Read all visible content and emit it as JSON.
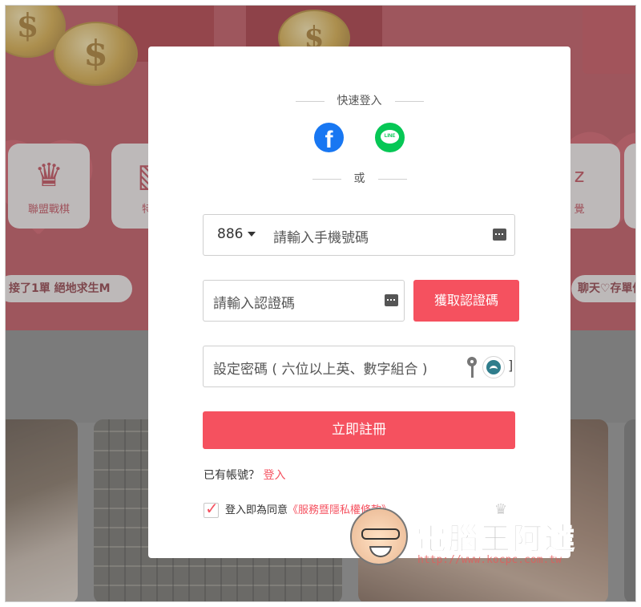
{
  "background": {
    "categories": [
      {
        "label": "聯盟戰棋",
        "icon": "crown-icon"
      },
      {
        "label": "特戰",
        "icon": "poster-icon"
      },
      {
        "label": "覺",
        "icon": "sleep-icon"
      }
    ],
    "ticker_left": "接了1單 絕地求生M",
    "ticker_right": "聊天♡存單優",
    "coin_symbol": "$"
  },
  "modal": {
    "quick_login_label": "快速登入",
    "or_label": "或",
    "social": [
      {
        "name": "facebook",
        "icon": "facebook-icon",
        "glyph": "f",
        "color": "#1877f2"
      },
      {
        "name": "line",
        "icon": "line-icon",
        "glyph": "LINE",
        "color": "#06c755"
      }
    ],
    "phone": {
      "country_code": "886",
      "placeholder": "請輸入手機號碼"
    },
    "verification": {
      "placeholder": "請輸入認證碼",
      "button_label": "獲取認證碼"
    },
    "password": {
      "placeholder": "設定密碼 ( 六位以上英、數字組合 )",
      "bracket": "]"
    },
    "register_label": "立即註冊",
    "have_account_text": "已有帳號？",
    "login_link": "登入",
    "agree_text": "登入即為同意",
    "terms_link": "《服務暨隱私權條款》",
    "agreed": true,
    "accent_color": "#f5515f"
  },
  "watermark": {
    "title": "電腦王阿達",
    "url": "http://www.kocpc.com.tw"
  }
}
